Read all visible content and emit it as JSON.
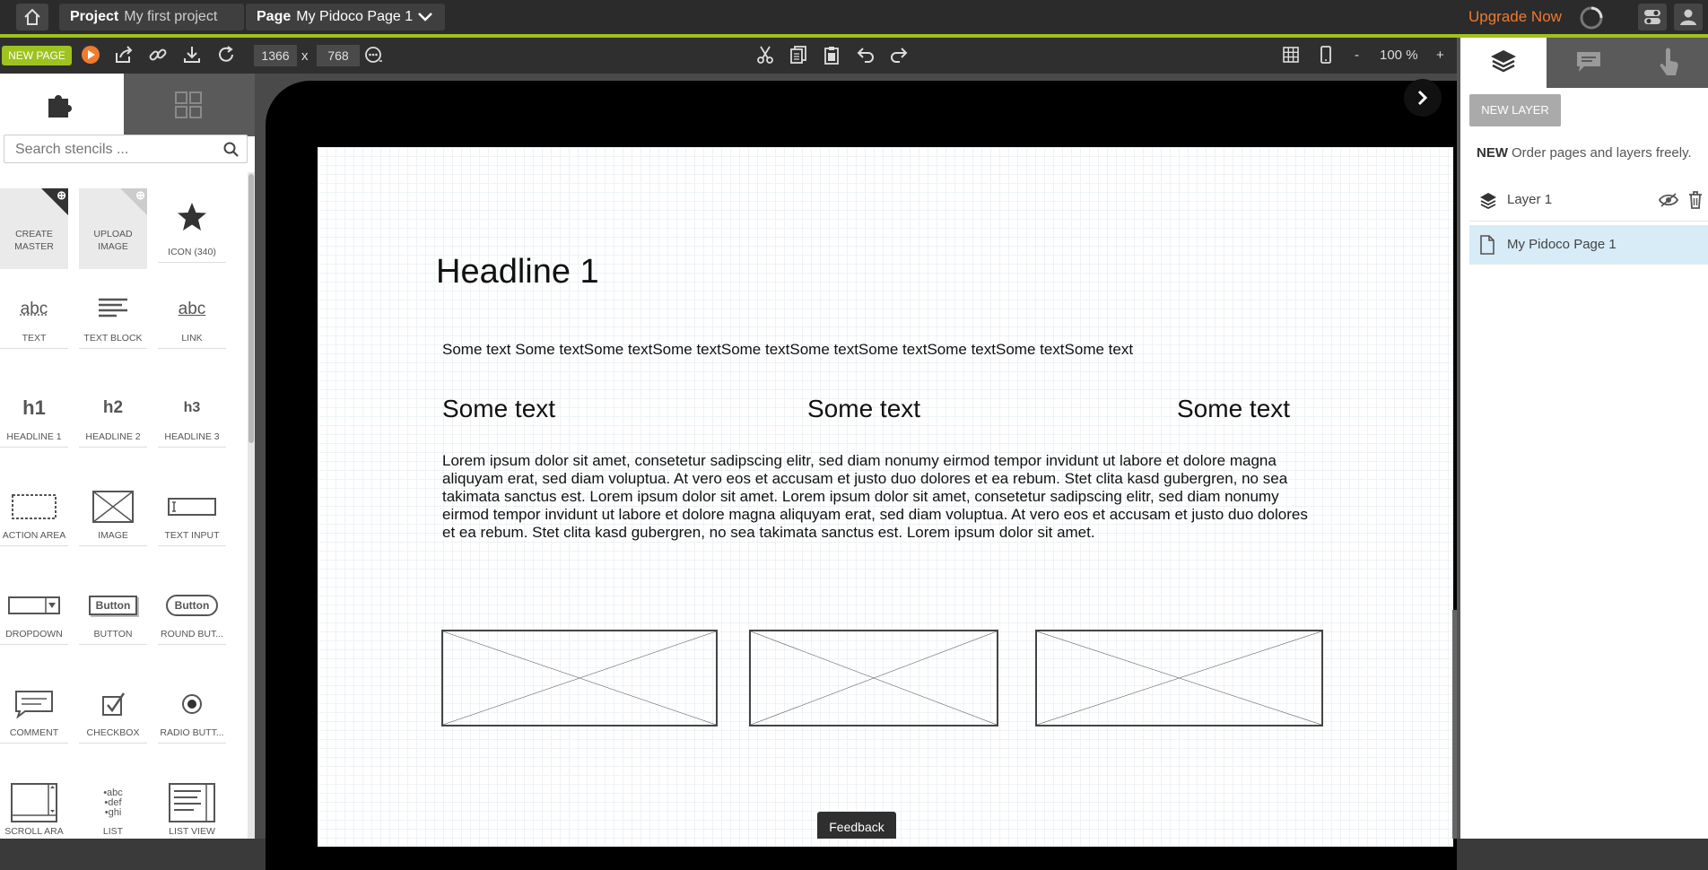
{
  "topbar": {
    "project_label": "Project",
    "project_name": "My first project",
    "page_label": "Page",
    "page_name": "My Pidoco Page 1",
    "upgrade": "Upgrade Now"
  },
  "toolbar": {
    "new_page": "NEW PAGE",
    "width": "1366",
    "x_sep": "x",
    "height": "768",
    "zoom_minus": "-",
    "zoom": "100 %",
    "zoom_plus": "+"
  },
  "stencils": {
    "search_placeholder": "Search stencils ...",
    "items": [
      {
        "label": "CREATE MASTER",
        "icon": "create-master-icon"
      },
      {
        "label": "UPLOAD IMAGE",
        "icon": "upload-image-icon"
      },
      {
        "label": "ICON (340)",
        "icon": "star-icon"
      },
      {
        "label": "TEXT",
        "icon": "text-abc-icon"
      },
      {
        "label": "TEXT BLOCK",
        "icon": "text-block-icon"
      },
      {
        "label": "LINK",
        "icon": "link-abc-icon"
      },
      {
        "label": "HEADLINE 1",
        "icon": "h1-icon"
      },
      {
        "label": "HEADLINE 2",
        "icon": "h2-icon"
      },
      {
        "label": "HEADLINE 3",
        "icon": "h3-icon"
      },
      {
        "label": "ACTION AREA",
        "icon": "action-area-icon"
      },
      {
        "label": "IMAGE",
        "icon": "image-placeholder-icon"
      },
      {
        "label": "TEXT INPUT",
        "icon": "text-input-icon"
      },
      {
        "label": "DROPDOWN",
        "icon": "dropdown-icon"
      },
      {
        "label": "BUTTON",
        "icon": "button-icon"
      },
      {
        "label": "ROUND BUT...",
        "icon": "round-button-icon"
      },
      {
        "label": "COMMENT",
        "icon": "comment-icon"
      },
      {
        "label": "CHECKBOX",
        "icon": "checkbox-icon"
      },
      {
        "label": "RADIO BUTT...",
        "icon": "radio-button-icon"
      },
      {
        "label": "SCROLL ARA",
        "icon": "scroll-area-icon"
      },
      {
        "label": "LIST",
        "icon": "list-icon"
      },
      {
        "label": "LIST VIEW",
        "icon": "list-view-icon"
      }
    ],
    "h1": "h1",
    "h2": "h2",
    "h3": "h3",
    "abc": "abc",
    "button_text": "Button",
    "list_lines": [
      "•abc",
      "•def",
      "•ghi"
    ]
  },
  "canvas": {
    "headline": "Headline 1",
    "line": "Some text Some textSome textSome textSome textSome textSome textSome textSome textSome text",
    "col1": "Some text",
    "col2": "Some text",
    "col3": "Some text",
    "paragraph": "Lorem ipsum dolor sit amet, consetetur sadipscing elitr, sed diam nonumy eirmod tempor invidunt ut labore et dolore magna aliquyam erat, sed diam voluptua. At vero eos et accusam et justo duo dolores et ea rebum. Stet clita kasd gubergren, no sea takimata sanctus est. Lorem ipsum dolor sit amet. Lorem ipsum dolor sit amet, consetetur sadipscing elitr, sed diam nonumy eirmod tempor invidunt ut labore et dolore magna aliquyam erat, sed diam voluptua. At vero eos et accusam et justo duo dolores et ea rebum. Stet clita kasd gubergren, no sea takimata sanctus est. Lorem ipsum dolor sit amet."
  },
  "feedback": "Feedback",
  "layers_panel": {
    "new_layer": "NEW LAYER",
    "note_bold": "NEW",
    "note": "Order pages and layers freely.",
    "layer1": "Layer 1",
    "page1": "My Pidoco Page 1"
  },
  "colors": {
    "accent": "#9ec21f",
    "upgrade": "#f07a2f",
    "selected_row": "#d8ecf7"
  }
}
